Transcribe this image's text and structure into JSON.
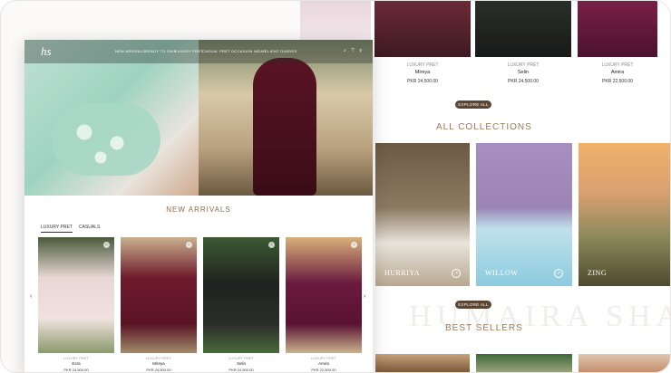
{
  "back_page": {
    "top_products": [
      {
        "category": "LUXURY PRET",
        "name": "Mireya",
        "price": "PKR 24,500.00"
      },
      {
        "category": "LUXURY PRET",
        "name": "Selin",
        "price": "PKR 24,500.00"
      },
      {
        "category": "LUXURY PRET",
        "name": "Amira",
        "price": "PKR 22,500.00"
      }
    ],
    "explore_label_1": "EXPLORE ALL",
    "collections_title": "ALL COLLECTIONS",
    "collections": [
      {
        "label": "HURRIYA"
      },
      {
        "label": "WILLOW"
      },
      {
        "label": "ZING"
      }
    ],
    "explore_label_2": "EXPLORE ALL",
    "watermark": "HUMAIRA SHA",
    "best_sellers_title": "BEST SELLERS"
  },
  "front_page": {
    "logo": "hs",
    "nav": [
      "NEW ARRIVALS",
      "READY TO SHIP",
      "LUXURY PRET",
      "CASUAL PRET",
      "OCCASION WEAR",
      "CLIENT DIARIES"
    ],
    "nav_icons": "⌕ ♡ ⚲",
    "new_arrivals_title": "NEW ARRIVALS",
    "tabs": [
      "LUXURY PRET",
      "CASUALS"
    ],
    "products": [
      {
        "category": "LUXURY PRET",
        "name": "Esra",
        "price": "PKR 24,500.00"
      },
      {
        "category": "LUXURY PRET",
        "name": "Mireya",
        "price": "PKR 24,500.00"
      },
      {
        "category": "LUXURY PRET",
        "name": "Selin",
        "price": "PKR 24,500.00"
      },
      {
        "category": "LUXURY PRET",
        "name": "Amira",
        "price": "PKR 22,500.00"
      }
    ],
    "arrow_left": "‹",
    "arrow_right": "›"
  }
}
